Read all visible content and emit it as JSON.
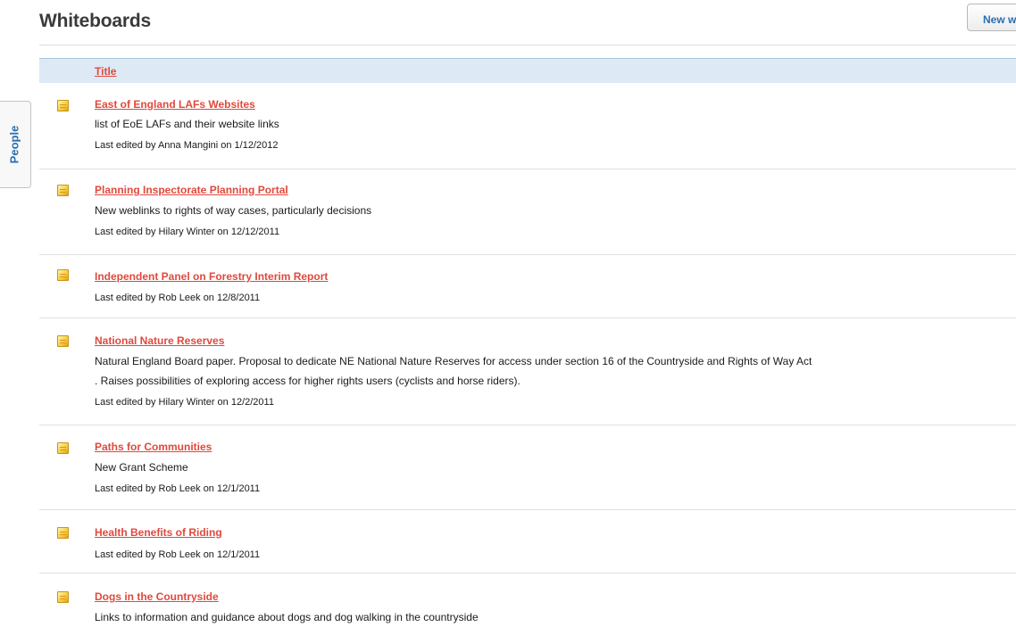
{
  "page": {
    "title": "Whiteboards"
  },
  "toolbar": {
    "new_label": "New whiteboard"
  },
  "table": {
    "column_title": "Title"
  },
  "side_tab": {
    "label": "People"
  },
  "whiteboards": [
    {
      "title": "East of England LAFs Websites",
      "desc_lines": [
        "list of EoE LAFs and their website links"
      ],
      "meta": "Last edited by Anna Mangini on 1/12/2012"
    },
    {
      "title": "Planning Inspectorate Planning Portal",
      "desc_lines": [
        "New weblinks to rights of way cases, particularly decisions"
      ],
      "meta": "Last edited by Hilary Winter on 12/12/2011"
    },
    {
      "title": "Independent Panel on Forestry Interim Report",
      "desc_lines": [],
      "meta": "Last edited by Rob Leek on 12/8/2011"
    },
    {
      "title": "National Nature Reserves",
      "desc_lines": [
        "Natural England Board paper. Proposal to dedicate NE National Nature Reserves for access under section 16 of the Countryside and Rights of Way Act",
        ". Raises possibilities of exploring access for higher rights users (cyclists and horse riders)."
      ],
      "meta": "Last edited by Hilary Winter on 12/2/2011"
    },
    {
      "title": "Paths for Communities",
      "desc_lines": [
        "New Grant Scheme"
      ],
      "meta": "Last edited by Rob Leek on 12/1/2011"
    },
    {
      "title": "Health Benefits of Riding",
      "desc_lines": [],
      "meta": "Last edited by Rob Leek on 12/1/2011"
    },
    {
      "title": "Dogs in the Countryside",
      "desc_lines": [
        "Links to information and guidance about dogs and dog walking in the countryside"
      ],
      "meta": ""
    }
  ]
}
